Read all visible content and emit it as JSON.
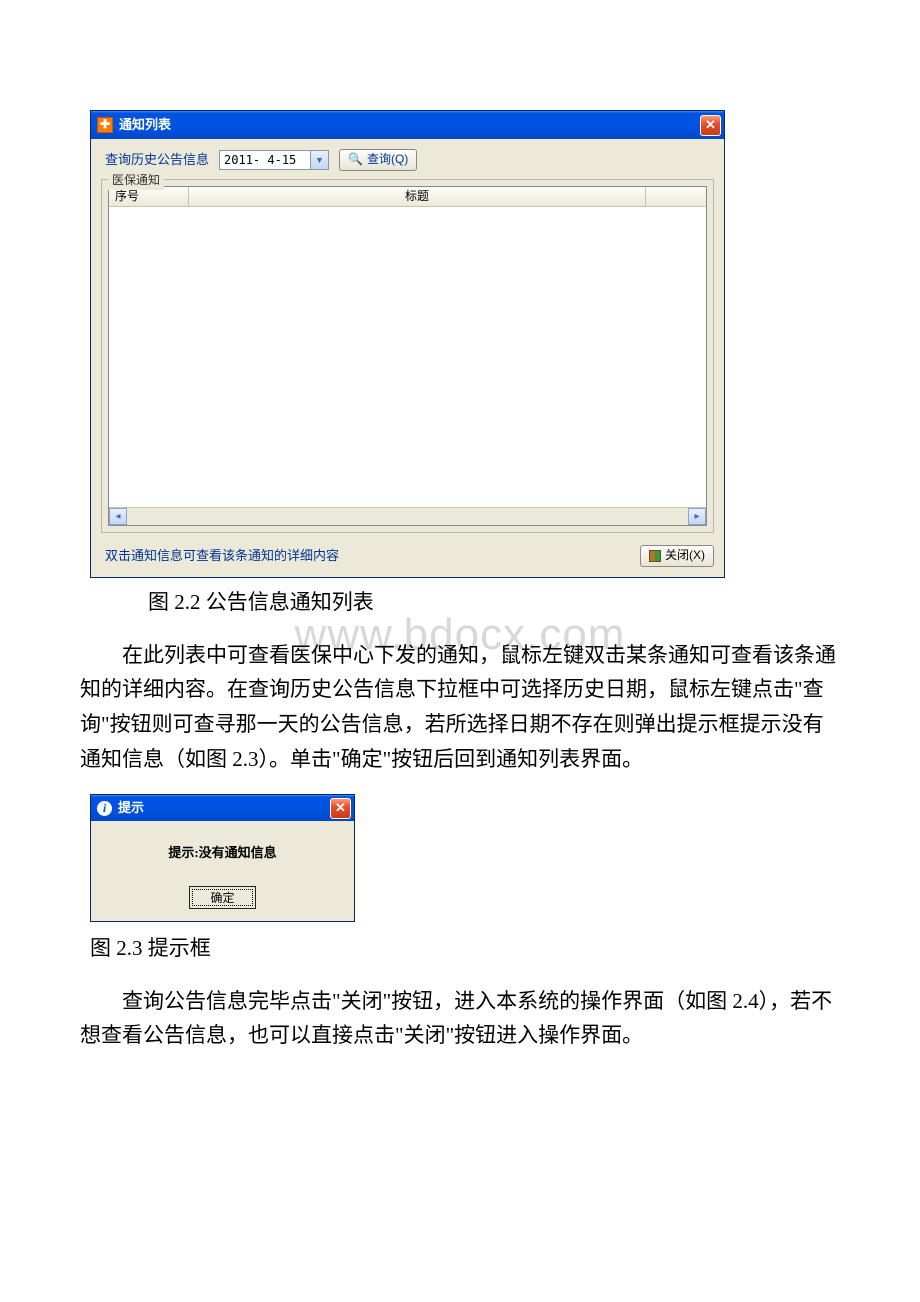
{
  "watermark": "www.bdocx.com",
  "window1": {
    "title": "通知列表",
    "query_label": "查询历史公告信息",
    "date_value": "2011- 4-15",
    "query_btn": "查询(Q)",
    "fieldset_legend": "医保通知",
    "col_seq": "序号",
    "col_title": "标题",
    "hint": "双击通知信息可查看该条通知的详细内容",
    "close_btn": "关闭(X)"
  },
  "caption1": "图 2.2 公告信息通知列表",
  "para1": "在此列表中可查看医保中心下发的通知，鼠标左键双击某条通知可查看该条通知的详细内容。在查询历史公告信息下拉框中可选择历史日期，鼠标左键点击\"查询\"按钮则可查寻那一天的公告信息，若所选择日期不存在则弹出提示框提示没有通知信息（如图 2.3）。单击\"确定\"按钮后回到通知列表界面。",
  "window2": {
    "title": "提示",
    "message": "提示:没有通知信息",
    "ok_btn": "确定"
  },
  "caption2": "图 2.3 提示框",
  "para2": "查询公告信息完毕点击\"关闭\"按钮，进入本系统的操作界面（如图 2.4），若不想查看公告信息，也可以直接点击\"关闭\"按钮进入操作界面。"
}
